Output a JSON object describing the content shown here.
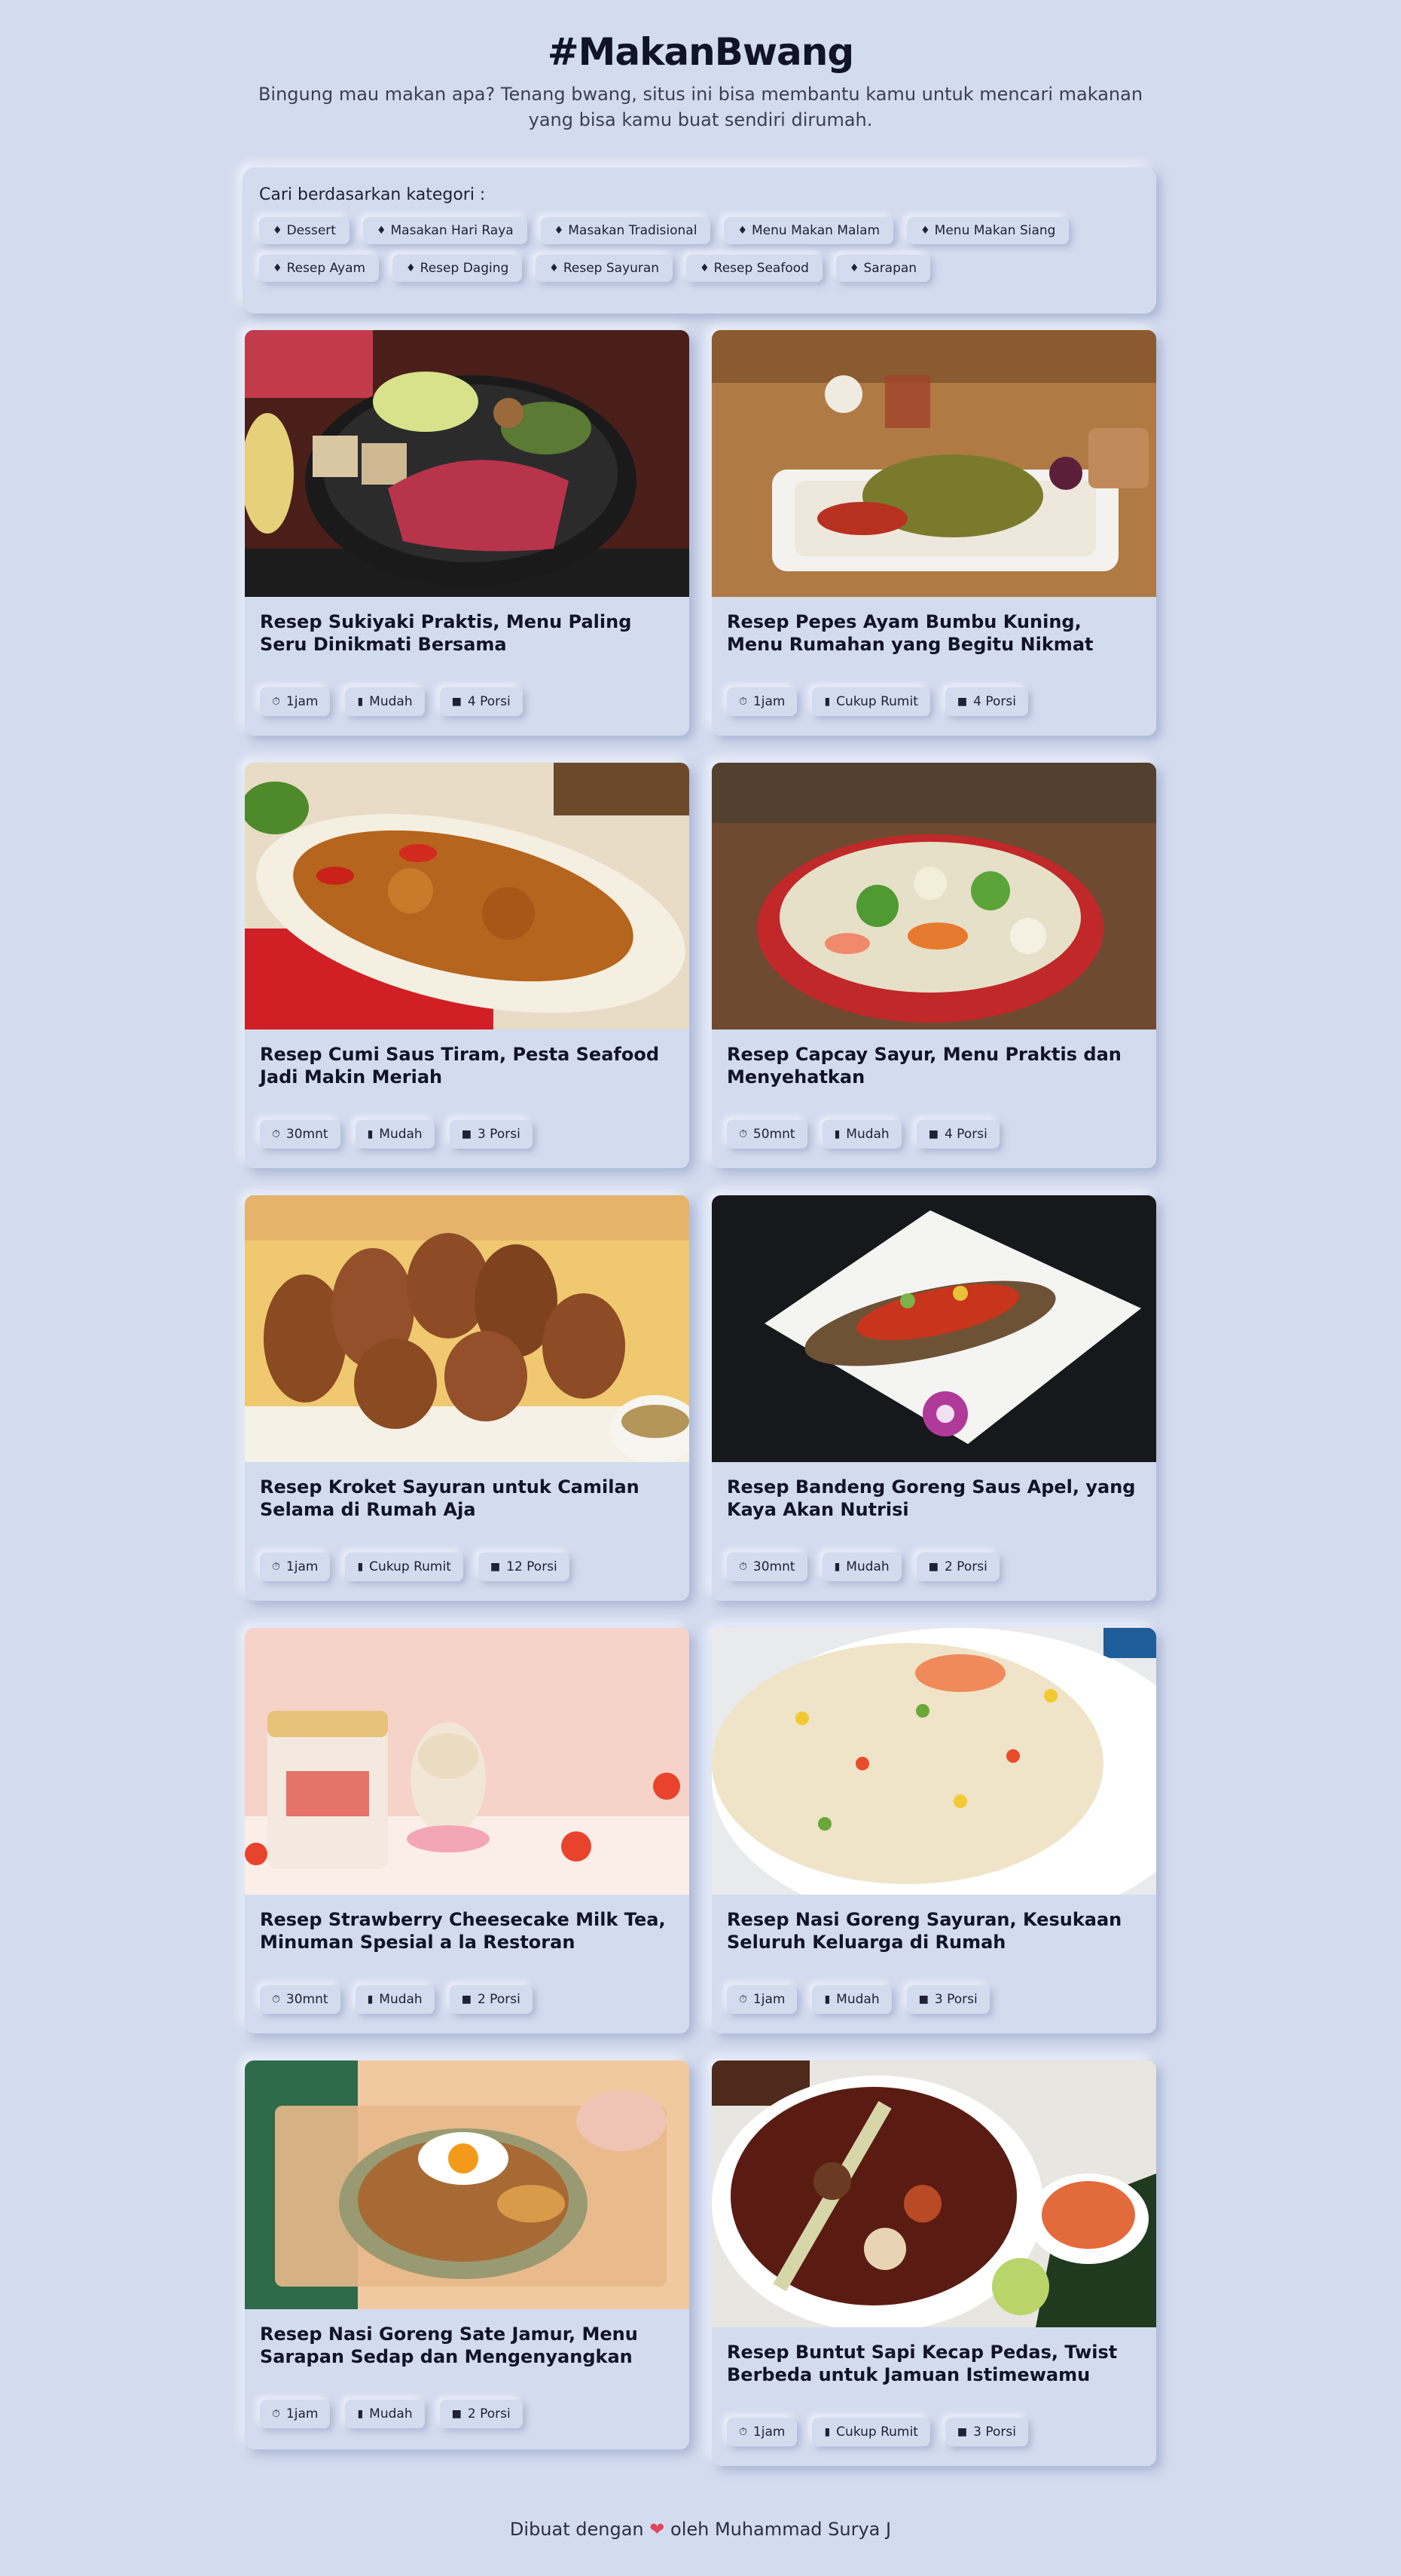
{
  "header": {
    "title": "#MakanBwang",
    "subtitle": "Bingung mau makan apa? Tenang bwang, situs ini bisa membantu kamu untuk mencari makanan yang bisa kamu buat sendiri dirumah."
  },
  "categories": {
    "heading": "Cari berdasarkan kategori :",
    "row1": [
      "Dessert",
      "Masakan Hari Raya",
      "Masakan Tradisional",
      "Menu Makan Malam",
      "Menu Makan Siang"
    ],
    "row2": [
      "Resep Ayam",
      "Resep Daging",
      "Resep Sayuran",
      "Resep Seafood",
      "Sarapan"
    ]
  },
  "recipes": [
    {
      "title": "Resep Sukiyaki Praktis, Menu Paling Seru Dinikmati Bersama",
      "time": "1jam",
      "difficulty": "Mudah",
      "portion": "4 Porsi",
      "image": "sukiyaki-hotpot"
    },
    {
      "title": "Resep Pepes Ayam Bumbu Kuning, Menu Rumahan yang Begitu Nikmat",
      "time": "1jam",
      "difficulty": "Cukup Rumit",
      "portion": "4 Porsi",
      "image": "pepes-ayam-tray"
    },
    {
      "title": "Resep Cumi Saus Tiram, Pesta Seafood Jadi Makin Meriah",
      "time": "30mnt",
      "difficulty": "Mudah",
      "portion": "3 Porsi",
      "image": "cumi-saus-tiram"
    },
    {
      "title": "Resep Capcay Sayur, Menu Praktis dan Menyehatkan",
      "time": "50mnt",
      "difficulty": "Mudah",
      "portion": "4 Porsi",
      "image": "capcay-red-bowl"
    },
    {
      "title": "Resep Kroket Sayuran untuk Camilan Selama di Rumah Aja",
      "time": "1jam",
      "difficulty": "Cukup Rumit",
      "portion": "12 Porsi",
      "image": "kroket-plate"
    },
    {
      "title": "Resep Bandeng Goreng Saus Apel, yang Kaya Akan Nutrisi",
      "time": "30mnt",
      "difficulty": "Mudah",
      "portion": "2 Porsi",
      "image": "fried-fish-plate"
    },
    {
      "title": "Resep Strawberry Cheesecake Milk Tea, Minuman Spesial a la Restoran",
      "time": "30mnt",
      "difficulty": "Mudah",
      "portion": "2 Porsi",
      "image": "strawberry-milk-tea"
    },
    {
      "title": "Resep Nasi Goreng Sayuran, Kesukaan Seluruh Keluarga di Rumah",
      "time": "1jam",
      "difficulty": "Mudah",
      "portion": "3 Porsi",
      "image": "fried-rice-plate"
    },
    {
      "title": "Resep Nasi Goreng Sate Jamur, Menu Sarapan Sedap dan Mengenyangkan",
      "time": "1jam",
      "difficulty": "Mudah",
      "portion": "2 Porsi",
      "image": "fried-rice-egg"
    },
    {
      "title": "Resep Buntut Sapi Kecap Pedas, Twist Berbeda untuk Jamuan Istimewamu",
      "time": "1jam",
      "difficulty": "Cukup Rumit",
      "portion": "3 Porsi",
      "image": "oxtail-soup"
    }
  ],
  "footer": {
    "prefix": "Dibuat dengan",
    "suffix": "oleh Muhammad Surya J"
  },
  "colors": {
    "background": "#d3dbef",
    "text": "#101428",
    "heart": "#e0475d"
  }
}
